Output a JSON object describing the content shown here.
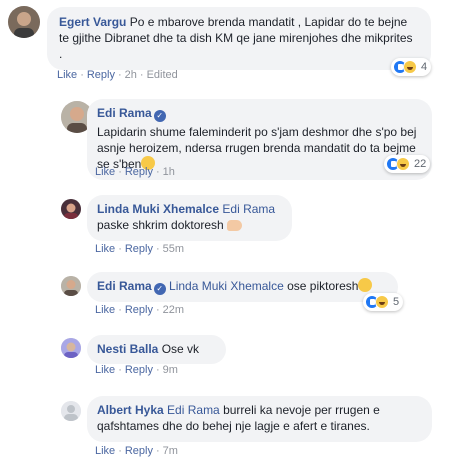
{
  "comments": [
    {
      "author": "Egert Vargu",
      "text": "Po e mbarove brenda mandatit , Lapidar do te bejne te gjithe Dibranet dhe ta dish KM qe jane mirenjohes dhe mikprites .",
      "actions": {
        "like": "Like",
        "reply": "Reply",
        "time": "2h",
        "edited": "Edited"
      },
      "reactions": {
        "count": "4",
        "icons": [
          "like-icon",
          "haha-icon"
        ]
      }
    },
    {
      "author": "Edi Rama",
      "text": "Lapidarin shume faleminderit po s'jam deshmor dhe s'po bej asnje heroizem, ndersa rrugen brenda mandatit do ta bejme se s'ben",
      "actions": {
        "like": "Like",
        "reply": "Reply",
        "time": "1h"
      },
      "reactions": {
        "count": "22",
        "icons": [
          "like-icon",
          "haha-icon"
        ]
      }
    },
    {
      "author": "Linda Muki Xhemalce",
      "mention": "Edi Rama",
      "text": "paske shkrim doktoresh",
      "actions": {
        "like": "Like",
        "reply": "Reply",
        "time": "55m"
      }
    },
    {
      "author": "Edi Rama",
      "mention": "Linda Muki Xhemalce",
      "text": "ose piktoresh",
      "actions": {
        "like": "Like",
        "reply": "Reply",
        "time": "22m"
      },
      "reactions": {
        "count": "5",
        "icons": [
          "like-icon",
          "haha-icon"
        ]
      }
    },
    {
      "author": "Nesti Balla",
      "text": "Ose vk",
      "actions": {
        "like": "Like",
        "reply": "Reply",
        "time": "9m"
      }
    },
    {
      "author": "Albert Hyka",
      "mention": "Edi Rama",
      "text": "burreli ka nevoje per rrugen e qafshtames dhe do behej nje lagje e afert e tiranes.",
      "actions": {
        "like": "Like",
        "reply": "Reply",
        "time": "7m"
      }
    }
  ],
  "colors": {
    "author": "#385898",
    "bubble": "#f2f3f5",
    "like": "#2078f4",
    "haha": "#f7c948",
    "verified": "#4267b2"
  }
}
